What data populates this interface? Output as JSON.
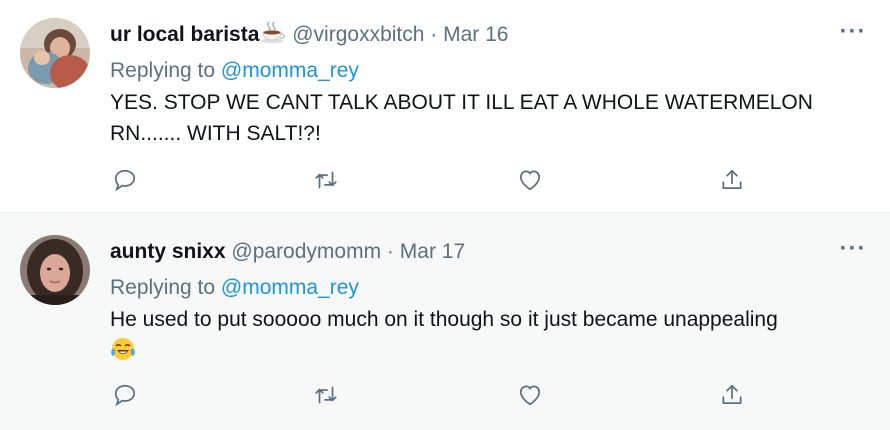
{
  "tweets": [
    {
      "display_name": "ur local barista",
      "name_emoji": "hot-beverage-emoji",
      "handle": "@virgoxxbitch",
      "dot": "·",
      "date": "Mar 16",
      "replying_label": "Replying to",
      "replying_to": "@momma_rey",
      "text": "YES. STOP WE CANT TALK ABOUT IT ILL EAT A WHOLE WATERMELON RN....... WITH SALT!?!",
      "more": "···"
    },
    {
      "display_name": "aunty snixx",
      "handle": "@parodymomm",
      "dot": "·",
      "date": "Mar 17",
      "replying_label": "Replying to",
      "replying_to": "@momma_rey",
      "text": "He used to put sooooo much on it though so it just became unappealing",
      "text_emoji": "tears-of-joy-emoji",
      "more": "···"
    }
  ],
  "actions": [
    "reply-icon",
    "retweet-icon",
    "like-icon",
    "share-icon"
  ],
  "colors": {
    "text": "#0f1419",
    "secondary": "#5b7083",
    "link": "#1b95e0",
    "divider": "#e6ecf0",
    "hover_bg": "#f7f9f9"
  }
}
